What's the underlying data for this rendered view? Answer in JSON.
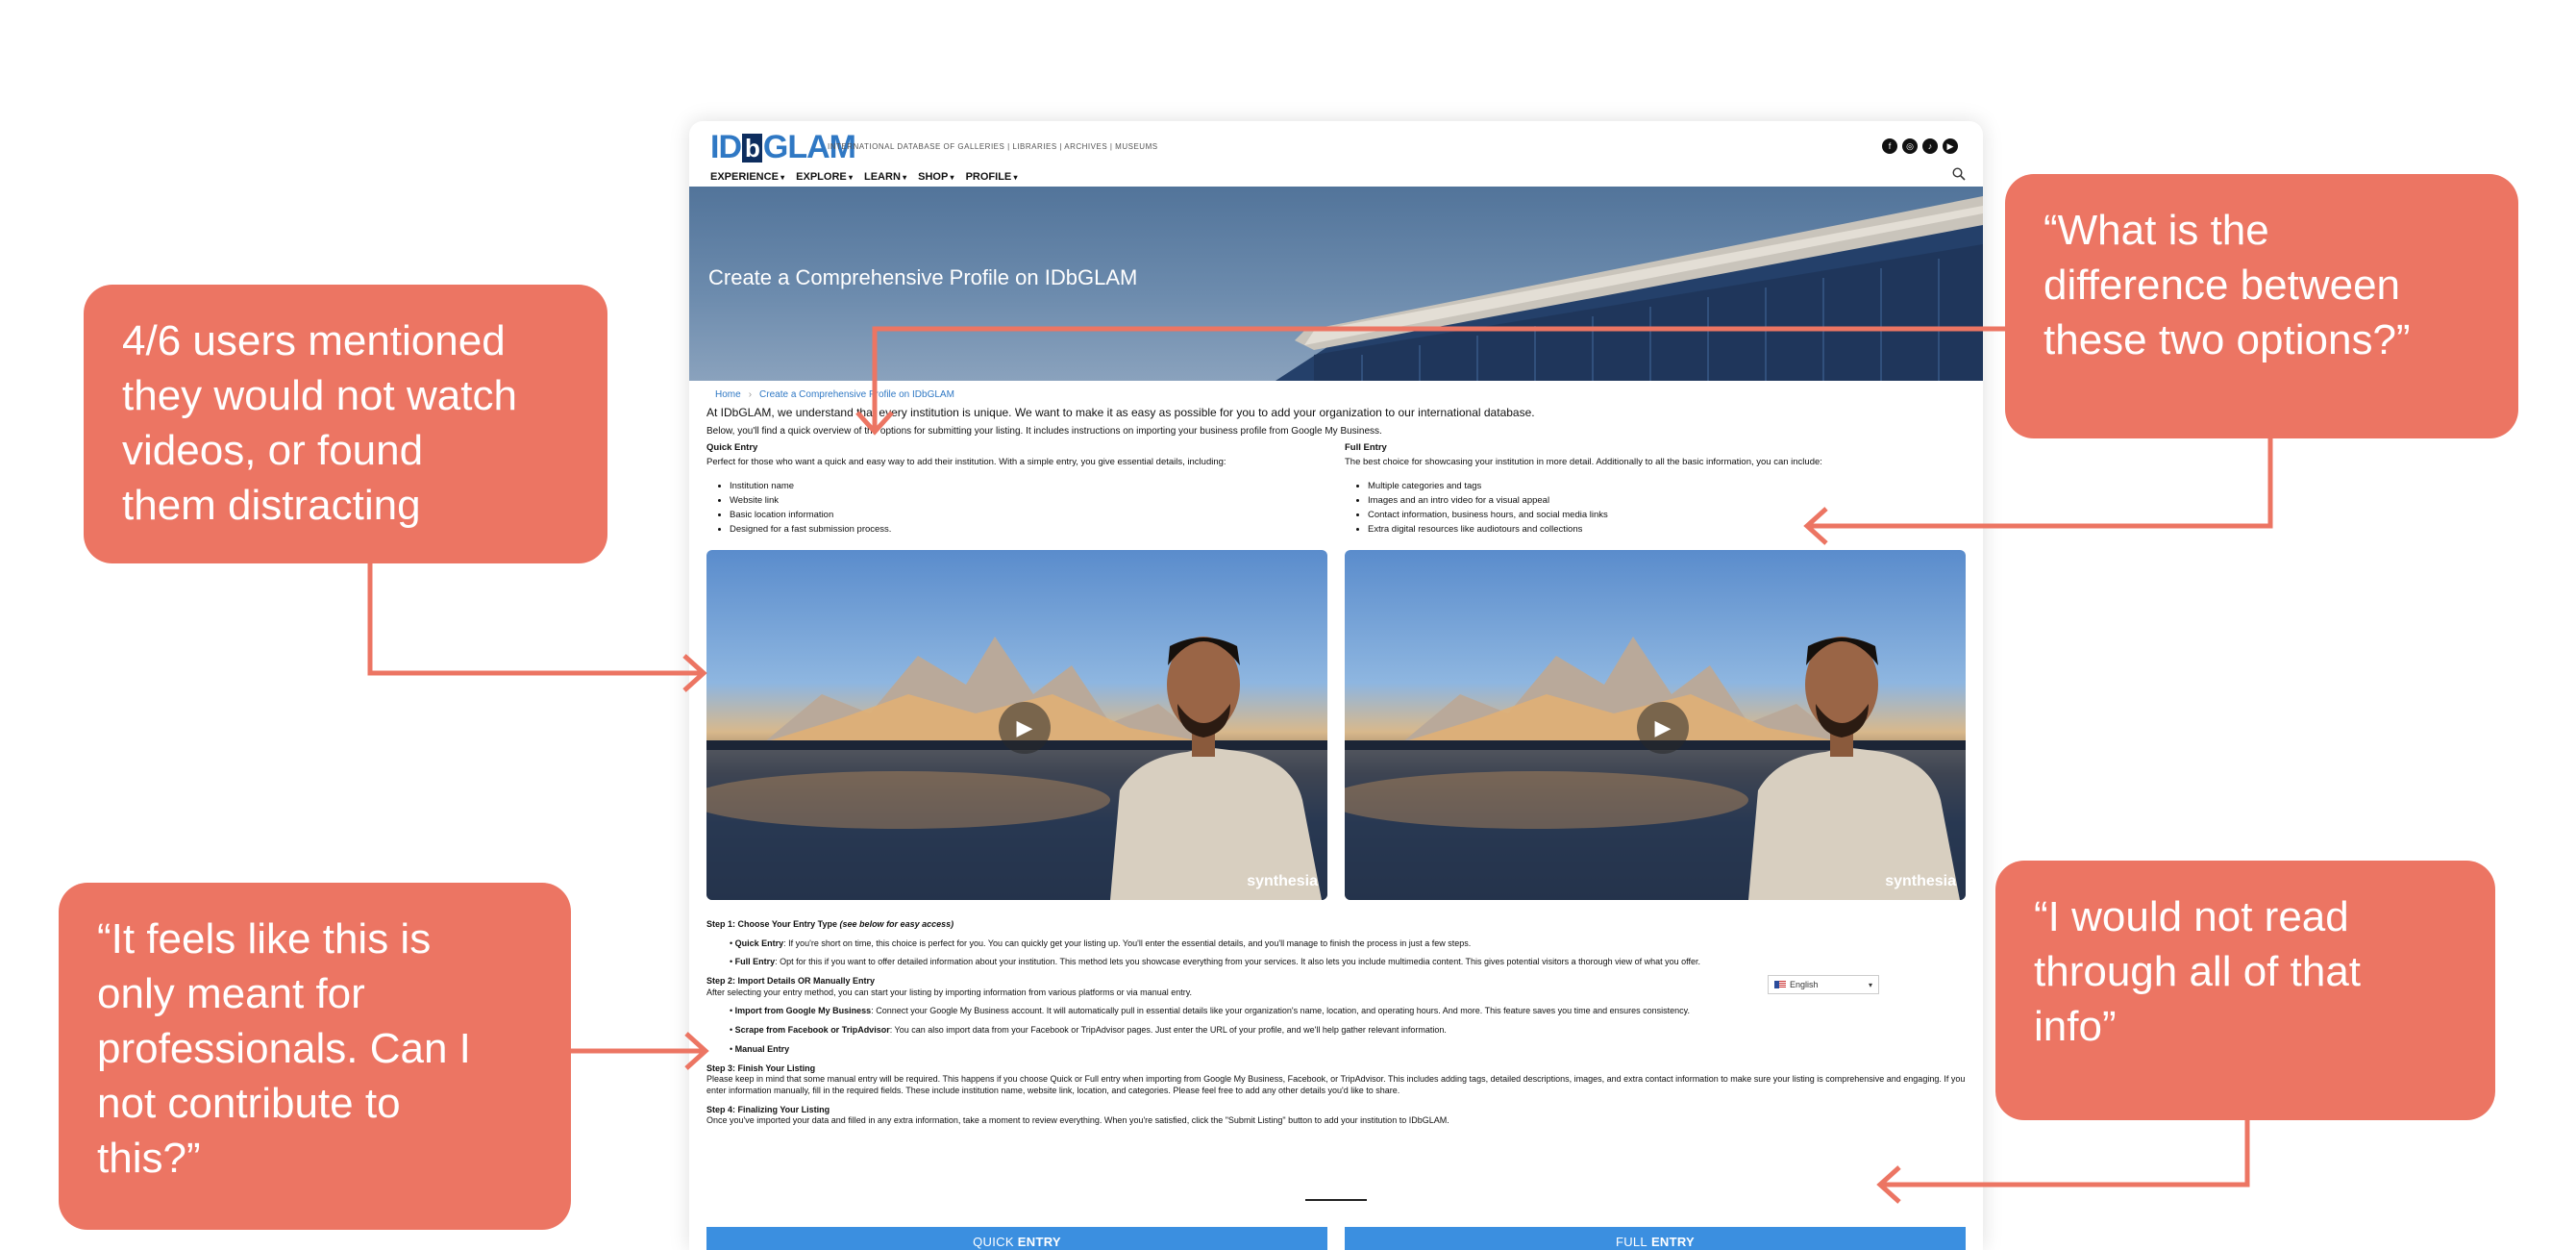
{
  "site": {
    "logo": {
      "pre": "ID",
      "mid": "b",
      "post": "GLAM"
    },
    "tagline": "INTERNATIONAL DATABASE OF GALLERIES | LIBRARIES | ARCHIVES | MUSEUMS",
    "social_icons": [
      "facebook-icon",
      "instagram-icon",
      "tiktok-icon",
      "youtube-icon"
    ],
    "nav": [
      "EXPERIENCE",
      "EXPLORE",
      "LEARN",
      "SHOP",
      "PROFILE"
    ],
    "hero_title": "Create a Comprehensive Profile on IDbGLAM",
    "breadcrumb": {
      "home": "Home",
      "current": "Create a Comprehensive Profile on IDbGLAM"
    },
    "intro1": "At IDbGLAM, we understand that every institution is unique. We want to make it as easy as possible for you to add your organization to our international database.",
    "intro2": "Below, you'll find a quick overview of the options for submitting your listing. It includes instructions on importing your business profile from Google My Business.",
    "quick": {
      "title": "Quick Entry",
      "desc": "Perfect for those who want a quick and easy way to add their institution. With a simple entry, you give essential details, including:",
      "items": [
        "Institution name",
        "Website link",
        "Basic location information",
        "Designed for a fast submission process."
      ]
    },
    "full": {
      "title": "Full Entry",
      "desc": "The best choice for showcasing your institution in more detail. Additionally to all the basic information, you can include:",
      "items": [
        "Multiple categories and tags",
        "Images and an intro video for a visual appeal",
        "Contact information, business hours, and social media links",
        "Extra digital resources like audiotours and collections"
      ]
    },
    "video_brand": "synthesia",
    "steps": {
      "s1_title": "Step 1: Choose Your Entry Type",
      "s1_note": "(see below for easy access)",
      "s1_quick_label": "Quick Entry",
      "s1_quick_text": ": If you're short on time, this choice is perfect for you. You can quickly get your listing up. You'll enter the essential details, and you'll manage to finish the process in just a few steps.",
      "s1_full_label": "Full Entry",
      "s1_full_text": ": Opt for this if you want to offer detailed information about your institution. This method lets you showcase everything from your services. It also lets you include multimedia content. This gives potential visitors a thorough view of what you offer.",
      "s2_title": "Step 2: Import Details OR Manually Entry",
      "s2_text": "After selecting your entry method, you can start your listing by importing information from various platforms or via manual entry.",
      "s2_google_label": "Import from Google My Business",
      "s2_google_text": ": Connect your Google My Business account. It will automatically pull in essential details like your organization's name, location, and operating hours. And more. This feature saves you time and ensures consistency.",
      "s2_fb_label": "Scrape from Facebook or TripAdvisor",
      "s2_fb_text": ": You can also import data from your Facebook or TripAdvisor pages. Just enter the URL of your profile, and we'll help gather relevant information.",
      "s2_manual_label": "Manual Entry",
      "s3_title": "Step 3: Finish Your Listing",
      "s3_text": "Please keep in mind that some manual entry will be required. This happens if you choose Quick or Full entry when importing from Google My Business, Facebook, or TripAdvisor. This includes adding tags, detailed descriptions, images, and extra contact information to make sure your listing is comprehensive and engaging. If you enter information manually, fill in the required fields. These include institution name, website link, location, and categories. Please feel free to add any other details you'd like to share.",
      "s4_title": "Step 4: Finalizing Your Listing",
      "s4_text": "Once you've imported your data and filled in any extra information, take a moment to review everything. When you're satisfied, click the \"Submit Listing\" button to add your institution to IDbGLAM."
    },
    "language": "English",
    "buttons": {
      "quick_pre": "QUICK",
      "quick_bold": "ENTRY",
      "full_pre": "FULL",
      "full_bold": "ENTRY"
    }
  },
  "callouts": {
    "videos": [
      "4/6 users mentioned",
      "they would not watch",
      "videos, or found",
      "them distracting"
    ],
    "difference": [
      "“What is the",
      "difference between",
      "these two options?”"
    ],
    "professionals": [
      "“It feels like this is",
      "only meant for",
      "professionals. Can I",
      "not contribute to",
      "this?”"
    ],
    "read": [
      "“I would not read",
      "through all of that",
      "info”"
    ]
  },
  "colors": {
    "callout": "#ec7563",
    "accent": "#3b8fe0",
    "logo": "#2f78c4"
  }
}
